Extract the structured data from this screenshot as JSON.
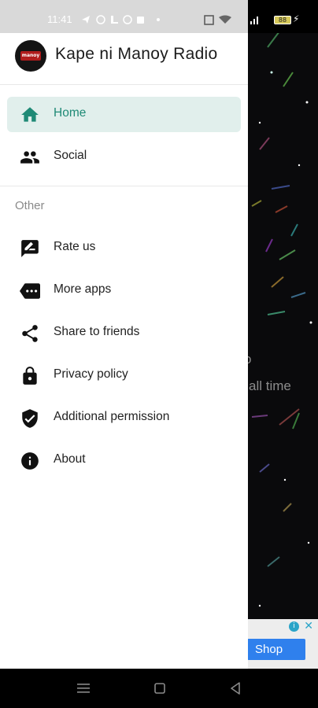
{
  "status_bar": {
    "time": "11:41",
    "battery": "88"
  },
  "drawer": {
    "app_title": "Kape ni Manoy Radio",
    "logo_text": "manoy",
    "menu": [
      {
        "label": "Home",
        "icon": "home-icon",
        "active": true
      },
      {
        "label": "Social",
        "icon": "people-icon",
        "active": false
      }
    ],
    "section_label": "Other",
    "other_items": [
      {
        "label": "Rate us",
        "icon": "rate-review-icon"
      },
      {
        "label": "More apps",
        "icon": "more-apps-icon"
      },
      {
        "label": "Share to friends",
        "icon": "share-icon"
      },
      {
        "label": "Privacy policy",
        "icon": "lock-icon"
      },
      {
        "label": "Additional permission",
        "icon": "shield-check-icon"
      },
      {
        "label": "About",
        "icon": "info-icon"
      }
    ]
  },
  "background": {
    "line1": "o",
    "line2": "all time",
    "paren": ")",
    "ad_button": "Shop"
  },
  "colors": {
    "accent": "#1f8a76",
    "active_bg": "#e1efec",
    "ad_button": "#2f80ed"
  }
}
